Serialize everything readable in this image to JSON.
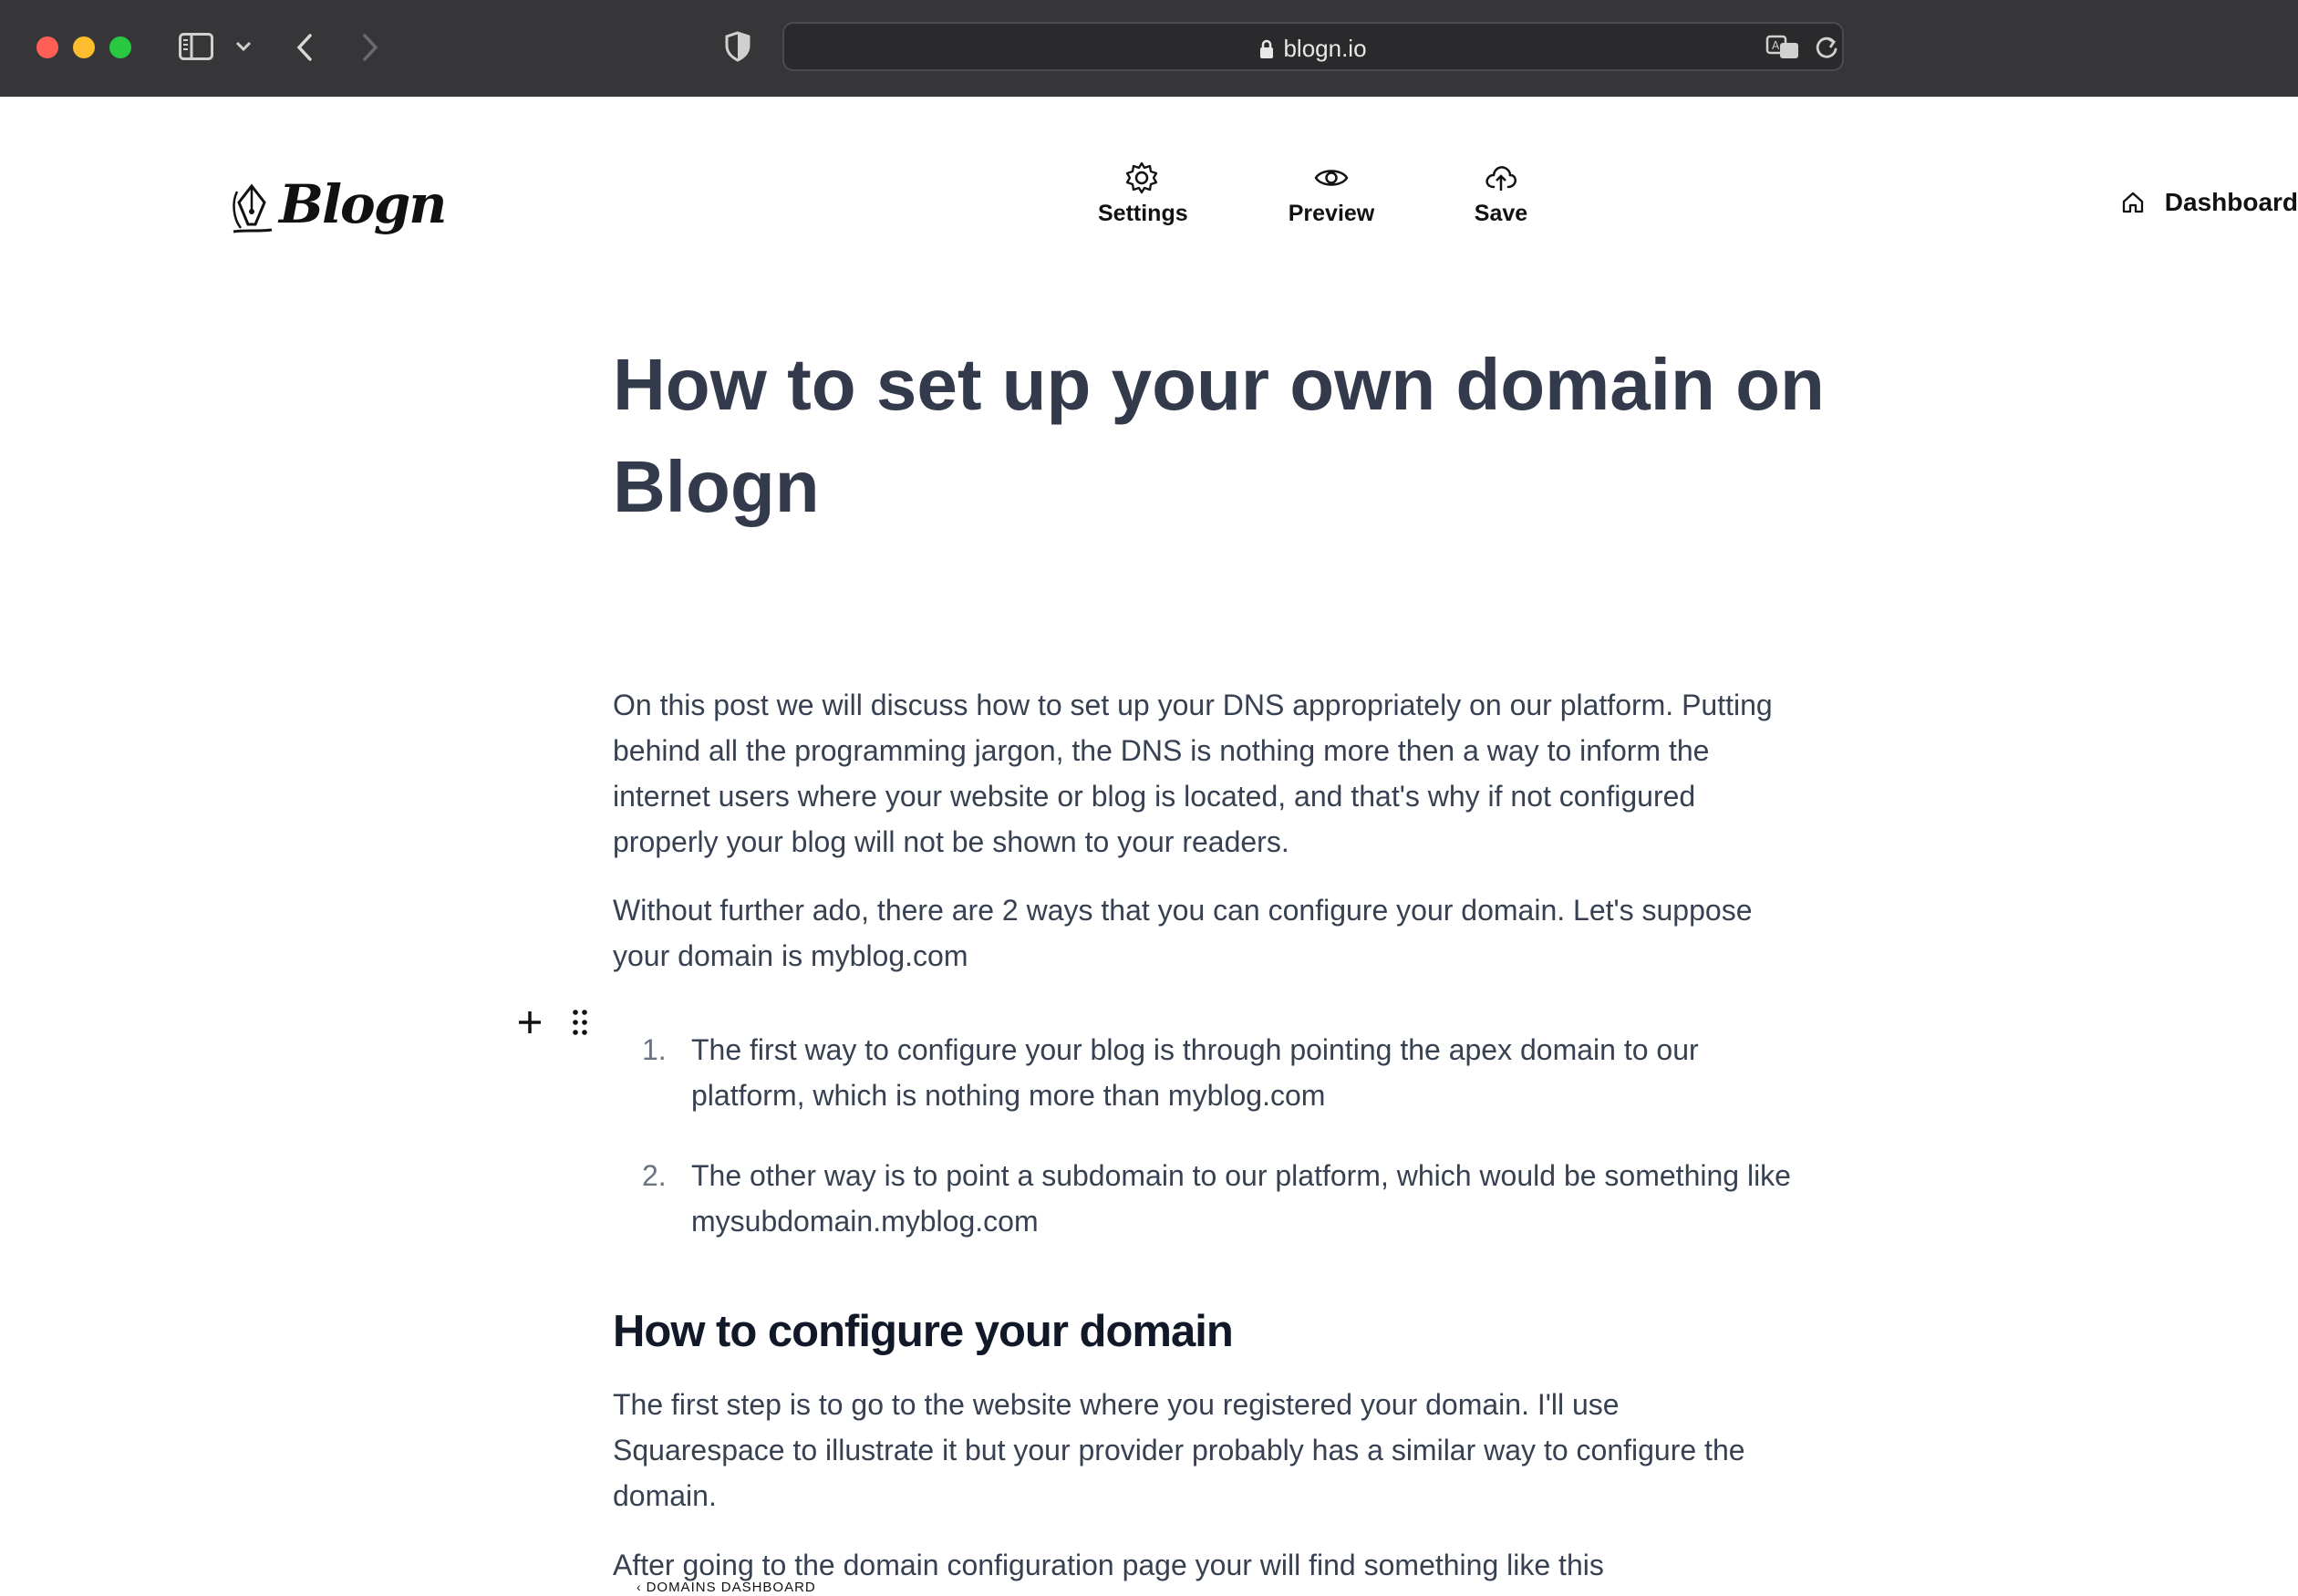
{
  "browser": {
    "url": "blogn.io"
  },
  "header": {
    "logo_text": "Blogn",
    "nav": {
      "settings": "Settings",
      "preview": "Preview",
      "save": "Save",
      "dashboard": "Dashboard"
    }
  },
  "post": {
    "title": "How to set up your own domain on Blogn",
    "paragraphs": [
      "On this post we will discuss how to set up your DNS appropriately on our platform. Putting behind all the programming jargon, the DNS is nothing more then a way to inform the internet users where your website or blog is located, and that's why if not configured properly your blog will not be shown to your readers.",
      "Without further ado, there are 2 ways that you can configure your domain. Let's suppose your domain is myblog.com"
    ],
    "list": [
      {
        "num": "1.",
        "text": "The first way to configure your blog is through pointing the apex domain to our platform, which is nothing more than myblog.com"
      },
      {
        "num": "2.",
        "text": "The other way is to point a subdomain to our platform, which would be something like mysubdomain.myblog.com"
      }
    ],
    "section_heading": "How to configure your domain",
    "section_paragraphs": [
      "The first step is to go to the website where you registered your domain. I'll use Squarespace to illustrate it but your provider probably has a similar way to configure the domain.",
      "After going to the domain configuration page your will find something like this"
    ],
    "image_caption_crumb": "DOMAINS DASHBOARD"
  },
  "colors": {
    "title": "#323a4b",
    "body_text": "#374151",
    "heading": "#111827",
    "chrome_bg": "#363638"
  },
  "icons": [
    "sidebar-icon",
    "chevron-down-icon",
    "back-icon",
    "forward-icon",
    "shield-icon",
    "lock-icon",
    "translate-icon",
    "reload-icon",
    "gear-icon",
    "eye-icon",
    "cloud-upload-icon",
    "home-icon",
    "plus-icon",
    "drag-handle-icon",
    "pen-nib-icon"
  ]
}
